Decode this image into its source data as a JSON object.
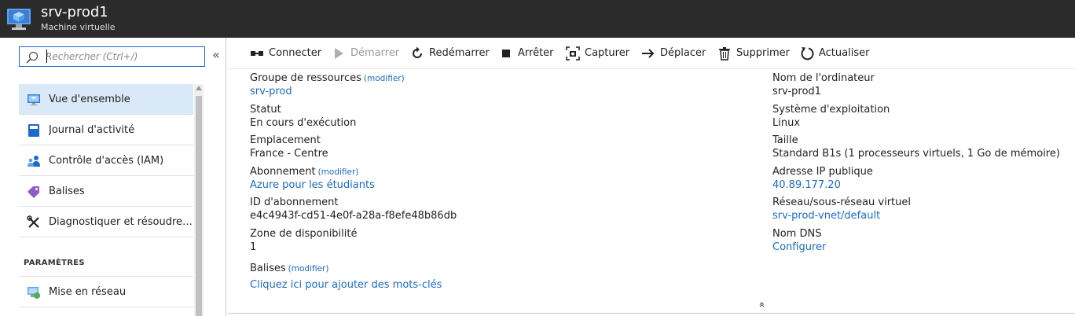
{
  "header": {
    "title": "srv-prod1",
    "subtitle": "Machine virtuelle"
  },
  "sidebar": {
    "search_placeholder": "Rechercher (Ctrl+/)",
    "collapse_glyph": "«",
    "items": [
      {
        "label": "Vue d'ensemble",
        "icon": "overview-icon"
      },
      {
        "label": "Journal d'activité",
        "icon": "activity-log-icon"
      },
      {
        "label": "Contrôle d'accès (IAM)",
        "icon": "access-control-icon"
      },
      {
        "label": "Balises",
        "icon": "tag-icon"
      },
      {
        "label": "Diagnostiquer et résoudre les...",
        "icon": "wrench-icon"
      }
    ],
    "section_title": "PARAMÈTRES",
    "settings_items": [
      {
        "label": "Mise en réseau",
        "icon": "network-icon"
      }
    ]
  },
  "toolbar": {
    "connect": "Connecter",
    "start": "Démarrer",
    "restart": "Redémarrer",
    "stop": "Arrêter",
    "capture": "Capturer",
    "move": "Déplacer",
    "delete": "Supprimer",
    "refresh": "Actualiser"
  },
  "essentials": {
    "modify": "(modifier)",
    "left": {
      "resource_group": {
        "label": "Groupe de ressources",
        "value": "srv-prod"
      },
      "status": {
        "label": "Statut",
        "value": "En cours d'exécution"
      },
      "location": {
        "label": "Emplacement",
        "value": "France - Centre"
      },
      "subscription": {
        "label": "Abonnement",
        "value": "Azure pour les étudiants"
      },
      "subscription_id": {
        "label": "ID d'abonnement",
        "value": "e4c4943f-cd51-4e0f-a28a-f8efe48b86db"
      },
      "availability_zone": {
        "label": "Zone de disponibilité",
        "value": "1"
      },
      "tags": {
        "label": "Balises",
        "value": "Cliquez ici pour ajouter des mots-clés"
      }
    },
    "right": {
      "computer_name": {
        "label": "Nom de l'ordinateur",
        "value": "srv-prod1"
      },
      "os": {
        "label": "Système d'exploitation",
        "value": "Linux"
      },
      "size": {
        "label": "Taille",
        "value": "Standard B1s (1 processeurs virtuels, 1 Go de mémoire)"
      },
      "public_ip": {
        "label": "Adresse IP publique",
        "value": "40.89.177.20"
      },
      "vnet": {
        "label": "Réseau/sous-réseau virtuel",
        "value": "srv-prod-vnet/default"
      },
      "dns": {
        "label": "Nom DNS",
        "value": "Configurer"
      }
    },
    "collapse_glyph": "«"
  },
  "colors": {
    "accent": "#1b6ac9",
    "header_bg": "#2b2b2b",
    "active_bg": "#d9e9f8"
  }
}
